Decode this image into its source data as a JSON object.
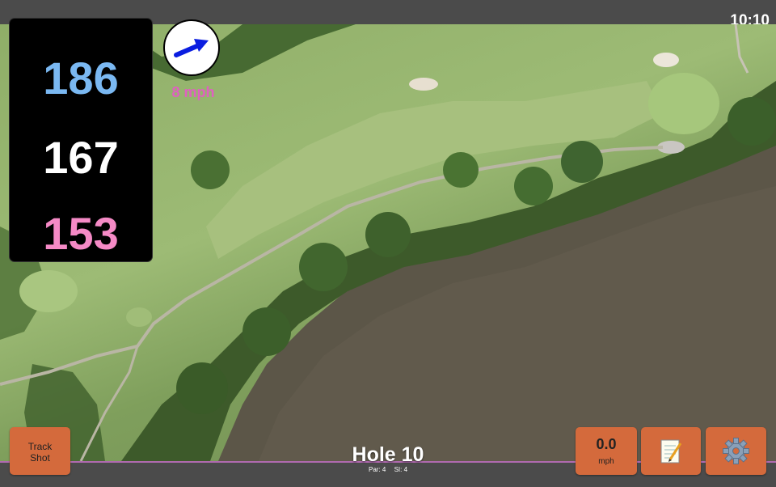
{
  "status": {
    "time": "10:10"
  },
  "distances": {
    "back": "186",
    "middle": "167",
    "front": "153"
  },
  "wind": {
    "speed_label": "8 mph",
    "arrow_color": "#0a1de0",
    "icon": "wind-arrow-icon"
  },
  "hole": {
    "title": "Hole 10",
    "par": "Par: 4",
    "stroke_index": "SI: 4"
  },
  "buttons": {
    "track_shot": "Track Shot",
    "speed_value": "0.0",
    "speed_unit": "mph",
    "notes_icon": "notepad-icon",
    "settings_icon": "gear-icon"
  },
  "colors": {
    "back": "#7ab8f2",
    "middle": "#ffffff",
    "front": "#f58ac6",
    "button": "#d46a3c",
    "accent_border": "#b06ab0"
  }
}
